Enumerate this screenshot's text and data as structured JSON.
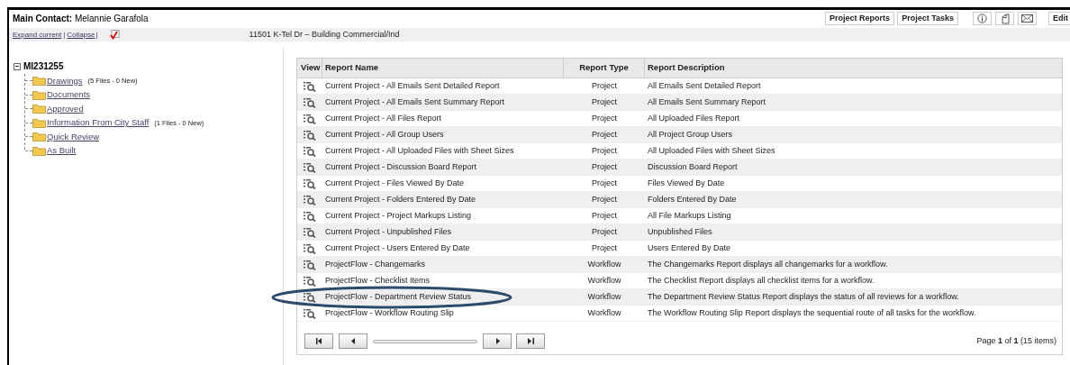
{
  "header": {
    "contact_label": "Main Contact:",
    "contact_name": "Melannie Garafola",
    "buttons": [
      "Project Reports",
      "Project Tasks"
    ],
    "edit_button": "Edit"
  },
  "toolbar": {
    "links": [
      "Expand current",
      "Collapse"
    ],
    "separators": [
      "|",
      "|"
    ],
    "project_title": "11501 K-Tel Dr – Building Commercial/Ind"
  },
  "tree": {
    "root": "MI231255",
    "expanded": true,
    "children": [
      {
        "label": "Drawings",
        "note": "(5 Files - 0 New)"
      },
      {
        "label": "Documents"
      },
      {
        "label": "Approved"
      },
      {
        "label": "Information From City Staff",
        "note": "(1 Files - 0 New)"
      },
      {
        "label": "Quick Review"
      },
      {
        "label": "As Built"
      }
    ]
  },
  "table": {
    "columns": [
      "View",
      "Report Name",
      "Report Type",
      "Report Description"
    ],
    "rows": [
      {
        "name": "Current Project - All Emails Sent Detailed Report",
        "type": "Project",
        "description": "All Emails Sent Detailed Report"
      },
      {
        "name": "Current Project - All Emails Sent Summary Report",
        "type": "Project",
        "description": "All Emails Sent Summary Report"
      },
      {
        "name": "Current Project - All Files Report",
        "type": "Project",
        "description": "All Uploaded Files Report"
      },
      {
        "name": "Current Project - All Group Users",
        "type": "Project",
        "description": "All Project Group Users"
      },
      {
        "name": "Current Project - All Uploaded Files with Sheet Sizes",
        "type": "Project",
        "description": "All Uploaded Files with Sheet Sizes"
      },
      {
        "name": "Current Project - Discussion Board Report",
        "type": "Project",
        "description": "Discussion Board Report"
      },
      {
        "name": "Current Project - Files Viewed By Date",
        "type": "Project",
        "description": "Files Viewed By Date"
      },
      {
        "name": "Current Project - Folders Entered By Date",
        "type": "Project",
        "description": "Folders Entered By Date"
      },
      {
        "name": "Current Project - Project Markups Listing",
        "type": "Project",
        "description": "All File Markups Listing"
      },
      {
        "name": "Current Project - Unpublished Files",
        "type": "Project",
        "description": "Unpublished Files"
      },
      {
        "name": "Current Project - Users Entered By Date",
        "type": "Project",
        "description": "Users Entered By Date"
      },
      {
        "name": "ProjectFlow - Changemarks",
        "type": "Workflow",
        "description": "The Changemarks Report displays all changemarks for a workflow."
      },
      {
        "name": "ProjectFlow - Checklist Items",
        "type": "Workflow",
        "description": "The Checklist Report displays all checklist items for a workflow."
      },
      {
        "name": "ProjectFlow - Department Review Status",
        "type": "Workflow",
        "description": "The Department Review Status Report displays the status of all reviews for a workflow.",
        "circled": true
      },
      {
        "name": "ProjectFlow - Workflow Routing Slip",
        "type": "Workflow",
        "description": "The Workflow Routing Slip Report displays the sequential route of all tasks for the workflow."
      }
    ]
  },
  "pager": {
    "summary": "Page **1** of **1** (15 items)"
  }
}
